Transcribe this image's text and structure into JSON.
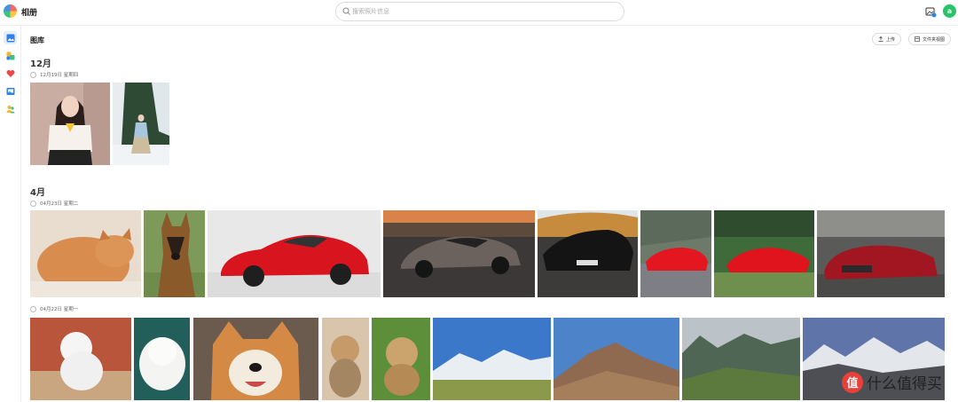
{
  "app": {
    "title": "相册",
    "avatar_initial": "a"
  },
  "search": {
    "placeholder": "搜索照片信息"
  },
  "sidebar": {
    "items": [
      {
        "name": "photos",
        "icon": "image-icon",
        "color": "#2f80ed",
        "active": true
      },
      {
        "name": "albums",
        "icon": "albums-icon",
        "color": "#3ac47d"
      },
      {
        "name": "favorites",
        "icon": "heart-icon",
        "color": "#e84a4a"
      },
      {
        "name": "folders",
        "icon": "folder-image-icon",
        "color": "#2f80ed"
      },
      {
        "name": "people",
        "icon": "people-icon",
        "color": "#f5b42a"
      }
    ]
  },
  "main": {
    "title": "图库",
    "upload_label": "上传",
    "folder_view_label": "文件夹视图",
    "groups": [
      {
        "month": "12月",
        "days": [
          {
            "date": "12月19日 星期四",
            "photos": [
              "girl-in-school-uniform",
              "girl-in-snowy-forest"
            ]
          }
        ]
      },
      {
        "month": "4月",
        "days": [
          {
            "date": "04月23日 星期二",
            "photos": [
              "orange-cat",
              "german-shepherd",
              "red-sports-car",
              "grey-supercar",
              "black-lamborghini",
              "red-ferrari-road",
              "red-ferrari-blur",
              "red-aston-martin"
            ]
          },
          {
            "date": "04月22日 星期一",
            "photos": [
              "white-poodle",
              "white-pomeranian",
              "shiba-inu",
              "small-dog",
              "yorkshire-terrier",
              "snowy-mountains",
              "desert-hills",
              "mountain-valley",
              "snow-peaks-lake"
            ]
          }
        ]
      }
    ]
  },
  "watermark": {
    "logo": "值",
    "text": "什么值得买"
  }
}
